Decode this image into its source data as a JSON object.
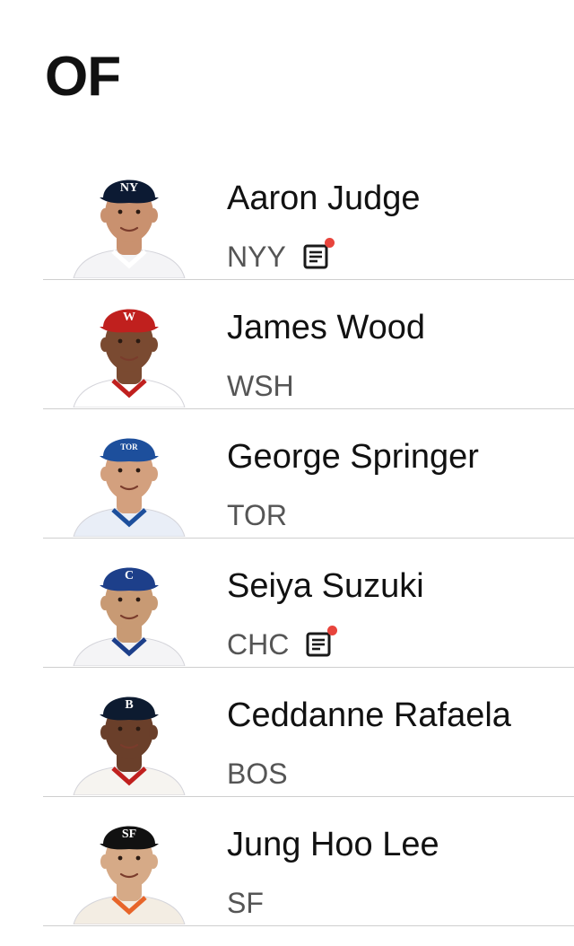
{
  "position_label": "OF",
  "accent_news_dot": "#e8443c",
  "players": [
    {
      "name": "Aaron Judge",
      "team": "NYY",
      "has_news": true,
      "cap_color": "#0c1a33",
      "cap_logo": "NY",
      "jersey": "#f4f4f6",
      "jersey_trim": "#ffffff",
      "skin": "#c9916f"
    },
    {
      "name": "James Wood",
      "team": "WSH",
      "has_news": false,
      "cap_color": "#c0201e",
      "cap_logo": "W",
      "jersey": "#ffffff",
      "jersey_trim": "#c0201e",
      "skin": "#7a4a31"
    },
    {
      "name": "George Springer",
      "team": "TOR",
      "has_news": false,
      "cap_color": "#1d4f9c",
      "cap_logo": "TOR",
      "jersey": "#e9eef7",
      "jersey_trim": "#1d4f9c",
      "skin": "#d3a07e"
    },
    {
      "name": "Seiya Suzuki",
      "team": "CHC",
      "has_news": true,
      "cap_color": "#1d3f8a",
      "cap_logo": "C",
      "jersey": "#f4f4f6",
      "jersey_trim": "#1d3f8a",
      "skin": "#c89a74"
    },
    {
      "name": "Ceddanne Rafaela",
      "team": "BOS",
      "has_news": false,
      "cap_color": "#0d1b30",
      "cap_logo": "B",
      "jersey": "#f6f4f0",
      "jersey_trim": "#c0201e",
      "skin": "#6a3f2a"
    },
    {
      "name": "Jung Hoo Lee",
      "team": "SF",
      "has_news": false,
      "cap_color": "#111111",
      "cap_logo": "SF",
      "jersey": "#f3ede3",
      "jersey_trim": "#e7652a",
      "skin": "#d6aa87"
    }
  ]
}
